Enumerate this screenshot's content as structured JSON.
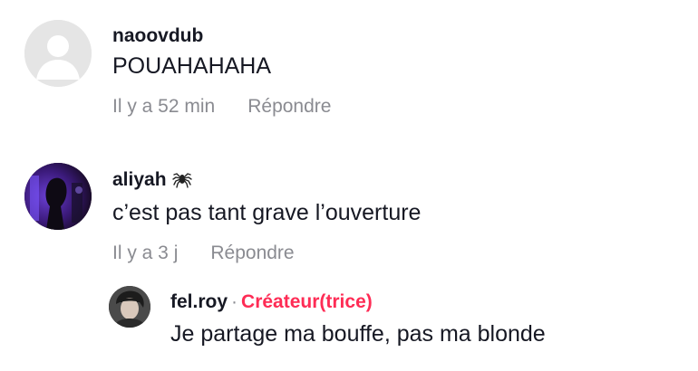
{
  "comments": [
    {
      "username": "naoovdub",
      "text": "POUAHAHAHA",
      "time": "Il y a 52 min",
      "reply_label": "Répondre",
      "avatar_icon": "default-user-icon"
    },
    {
      "username": "aliyah",
      "username_emoji_icon": "spider-icon",
      "text": "c’est pas tant grave l’ouverture",
      "time": "Il y a 3 j",
      "reply_label": "Répondre",
      "avatar_icon": "user-photo"
    }
  ],
  "reply": {
    "username": "fel.roy",
    "separator": "·",
    "creator_badge": "Créateur(trice)",
    "text": "Je partage ma bouffe, pas ma blonde",
    "avatar_icon": "user-photo"
  },
  "colors": {
    "text": "#161823",
    "muted": "#8a8b91",
    "creator": "#fe2c55",
    "avatar_placeholder": "#e5e5e5"
  }
}
